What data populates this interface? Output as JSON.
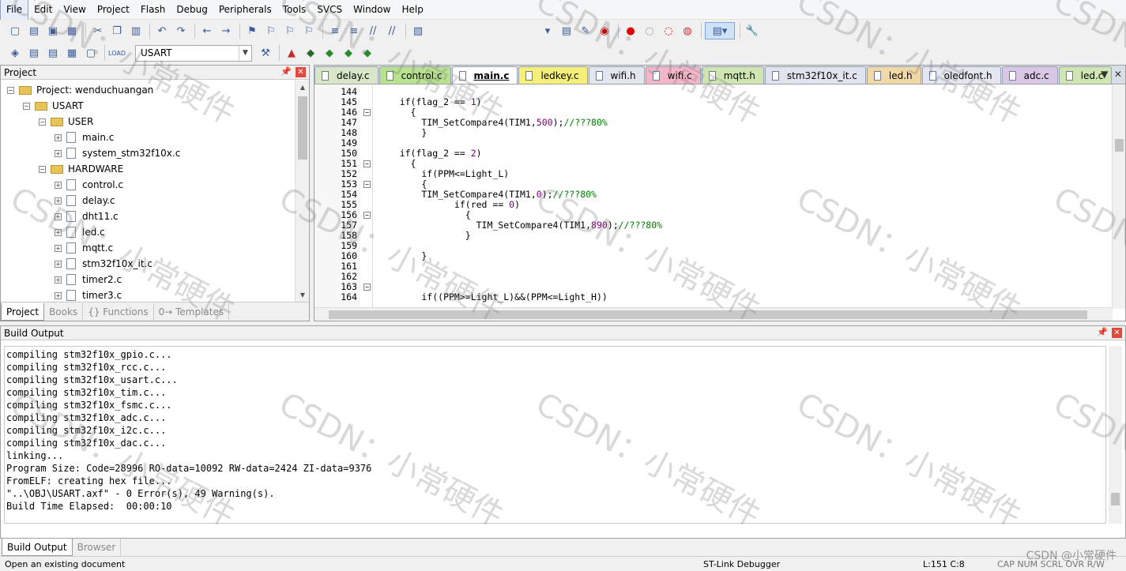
{
  "menu": [
    "File",
    "Edit",
    "View",
    "Project",
    "Flash",
    "Debug",
    "Peripherals",
    "Tools",
    "SVCS",
    "Window",
    "Help"
  ],
  "toolbar": {
    "target": "USART"
  },
  "project_panel": {
    "title": "Project",
    "tree": [
      {
        "label": "Project: wenduchuangan",
        "level": 0,
        "kind": "root"
      },
      {
        "label": "USART",
        "level": 1,
        "kind": "target"
      },
      {
        "label": "USER",
        "level": 2,
        "kind": "folder"
      },
      {
        "label": "main.c",
        "level": 3,
        "kind": "file"
      },
      {
        "label": "system_stm32f10x.c",
        "level": 3,
        "kind": "file"
      },
      {
        "label": "HARDWARE",
        "level": 2,
        "kind": "folder"
      },
      {
        "label": "control.c",
        "level": 3,
        "kind": "file"
      },
      {
        "label": "delay.c",
        "level": 3,
        "kind": "file"
      },
      {
        "label": "dht11.c",
        "level": 3,
        "kind": "file"
      },
      {
        "label": "led.c",
        "level": 3,
        "kind": "file"
      },
      {
        "label": "mqtt.c",
        "level": 3,
        "kind": "file"
      },
      {
        "label": "stm32f10x_it.c",
        "level": 3,
        "kind": "file"
      },
      {
        "label": "timer2.c",
        "level": 3,
        "kind": "file"
      },
      {
        "label": "timer3.c",
        "level": 3,
        "kind": "file"
      }
    ],
    "tabs": [
      "Project",
      "Books",
      "{} Functions",
      "0→ Templates"
    ]
  },
  "file_tabs": [
    {
      "name": "delay.c",
      "color": "#d9e6c8"
    },
    {
      "name": "control.c",
      "color": "#b9e28f"
    },
    {
      "name": "main.c",
      "color": "#ffffff",
      "active": true
    },
    {
      "name": "ledkey.c",
      "color": "#f5f07a"
    },
    {
      "name": "wifi.h",
      "color": "#e2e6ee"
    },
    {
      "name": "wifi.c",
      "color": "#f5b6c8"
    },
    {
      "name": "mqtt.h",
      "color": "#cfe6b2"
    },
    {
      "name": "stm32f10x_it.c",
      "color": "#dfe4ee"
    },
    {
      "name": "led.h",
      "color": "#f0d9a6"
    },
    {
      "name": "oledfont.h",
      "color": "#e4e7ef"
    },
    {
      "name": "adc.c",
      "color": "#d8c8e6"
    },
    {
      "name": "led.c",
      "color": "#cfe6b2"
    }
  ],
  "code_lines": [
    {
      "n": "144",
      "t": ""
    },
    {
      "n": "145",
      "t": "    if(flag_2 == 1)"
    },
    {
      "n": "146",
      "t": "      {"
    },
    {
      "n": "147",
      "t": "        TIM_SetCompare4(TIM1,500);//???80%"
    },
    {
      "n": "148",
      "t": "        }"
    },
    {
      "n": "149",
      "t": ""
    },
    {
      "n": "150",
      "t": "    if(flag_2 == 2)"
    },
    {
      "n": "151",
      "t": "      {"
    },
    {
      "n": "152",
      "t": "        if(PPM<=Light_L)"
    },
    {
      "n": "153",
      "t": "        {"
    },
    {
      "n": "154",
      "t": "        TIM_SetCompare4(TIM1,0);//???80%"
    },
    {
      "n": "155",
      "t": "              if(red == 0)"
    },
    {
      "n": "156",
      "t": "                {"
    },
    {
      "n": "157",
      "t": "                  TIM_SetCompare4(TIM1,890);//???80%"
    },
    {
      "n": "158",
      "t": "                }"
    },
    {
      "n": "159",
      "t": ""
    },
    {
      "n": "160",
      "t": "        }"
    },
    {
      "n": "161",
      "t": ""
    },
    {
      "n": "162",
      "t": ""
    },
    {
      "n": "163",
      "t": ""
    },
    {
      "n": "164",
      "t": "        if((PPM>=Light_L)&&(PPM<=Light_H))"
    }
  ],
  "build_output": {
    "title": "Build Output",
    "lines": [
      "compiling stm32f10x_gpio.c...",
      "compiling stm32f10x_rcc.c...",
      "compiling stm32f10x_usart.c...",
      "compiling stm32f10x_tim.c...",
      "compiling stm32f10x_fsmc.c...",
      "compiling stm32f10x_adc.c...",
      "compiling stm32f10x_i2c.c...",
      "compiling stm32f10x_dac.c...",
      "linking...",
      "Program Size: Code=28996 RO-data=10092 RW-data=2424 ZI-data=9376",
      "FromELF: creating hex file...",
      "\"..\\OBJ\\USART.axf\" - 0 Error(s), 49 Warning(s).",
      "Build Time Elapsed:  00:00:10"
    ],
    "tabs": [
      "Build Output",
      "Browser"
    ]
  },
  "status": {
    "left": "Open an existing document",
    "debugger": "ST-Link Debugger",
    "position": "L:151 C:8",
    "indicators": "CAP  NUM  SCRL  OVR  R/W"
  },
  "watermark": "CSDN：小常硬件",
  "footer_mark": "CSDN @小常硬件"
}
